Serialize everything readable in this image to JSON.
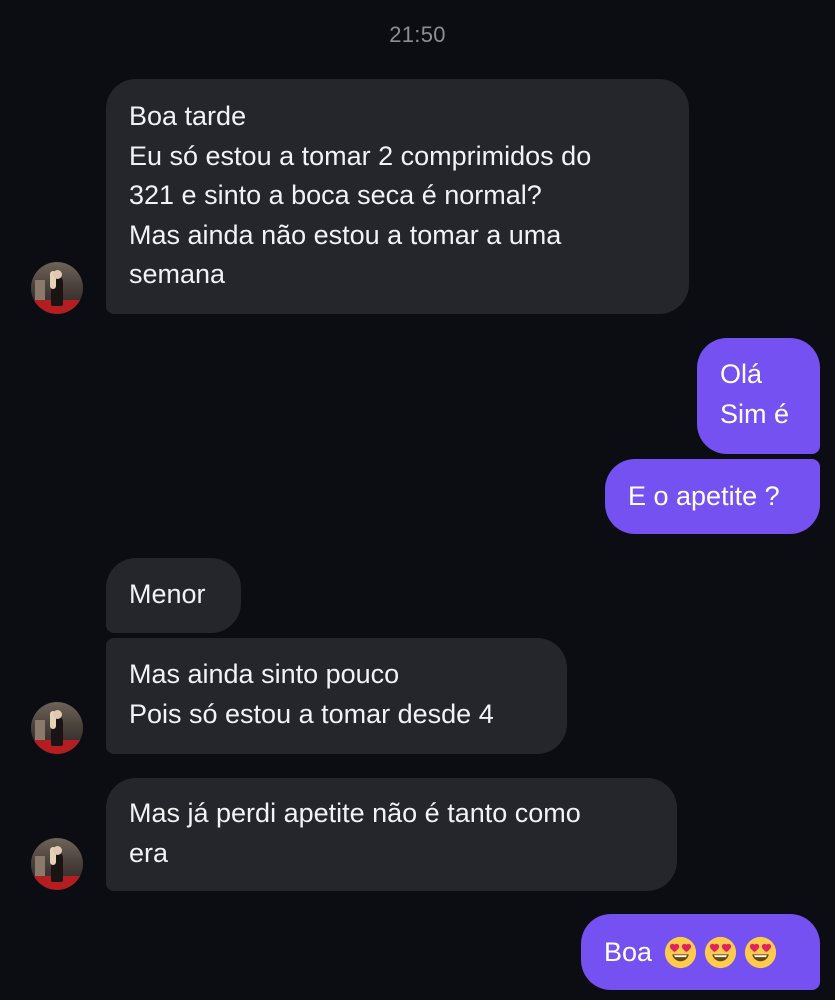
{
  "chat": {
    "timestamp": "21:50",
    "messages": [
      {
        "direction": "incoming",
        "lines": [
          "Boa tarde",
          "Eu só estou a tomar 2 comprimidos do",
          "321 e sinto a boca seca é normal?",
          "Mas ainda não estou a tomar a uma",
          "semana"
        ]
      },
      {
        "direction": "outgoing",
        "lines": [
          "Olá",
          "Sim é"
        ]
      },
      {
        "direction": "outgoing",
        "lines": [
          "E o apetite ?"
        ]
      },
      {
        "direction": "incoming",
        "lines": [
          "Menor"
        ]
      },
      {
        "direction": "incoming",
        "lines": [
          "Mas ainda sinto pouco",
          "Pois só estou a tomar desde 4"
        ]
      },
      {
        "direction": "incoming",
        "lines": [
          "Mas já perdi apetite não é tanto como",
          "era"
        ]
      },
      {
        "direction": "outgoing",
        "text": "Boa",
        "emojis": [
          "heart-eyes-emoji",
          "heart-eyes-emoji",
          "heart-eyes-emoji"
        ]
      }
    ]
  },
  "colors": {
    "background": "#0c0c13",
    "incoming_bubble": "#25262c",
    "outgoing_bubble": "#7551f1",
    "timestamp_text": "#8d8d96"
  },
  "avatar": {
    "icon": "contact-avatar"
  }
}
